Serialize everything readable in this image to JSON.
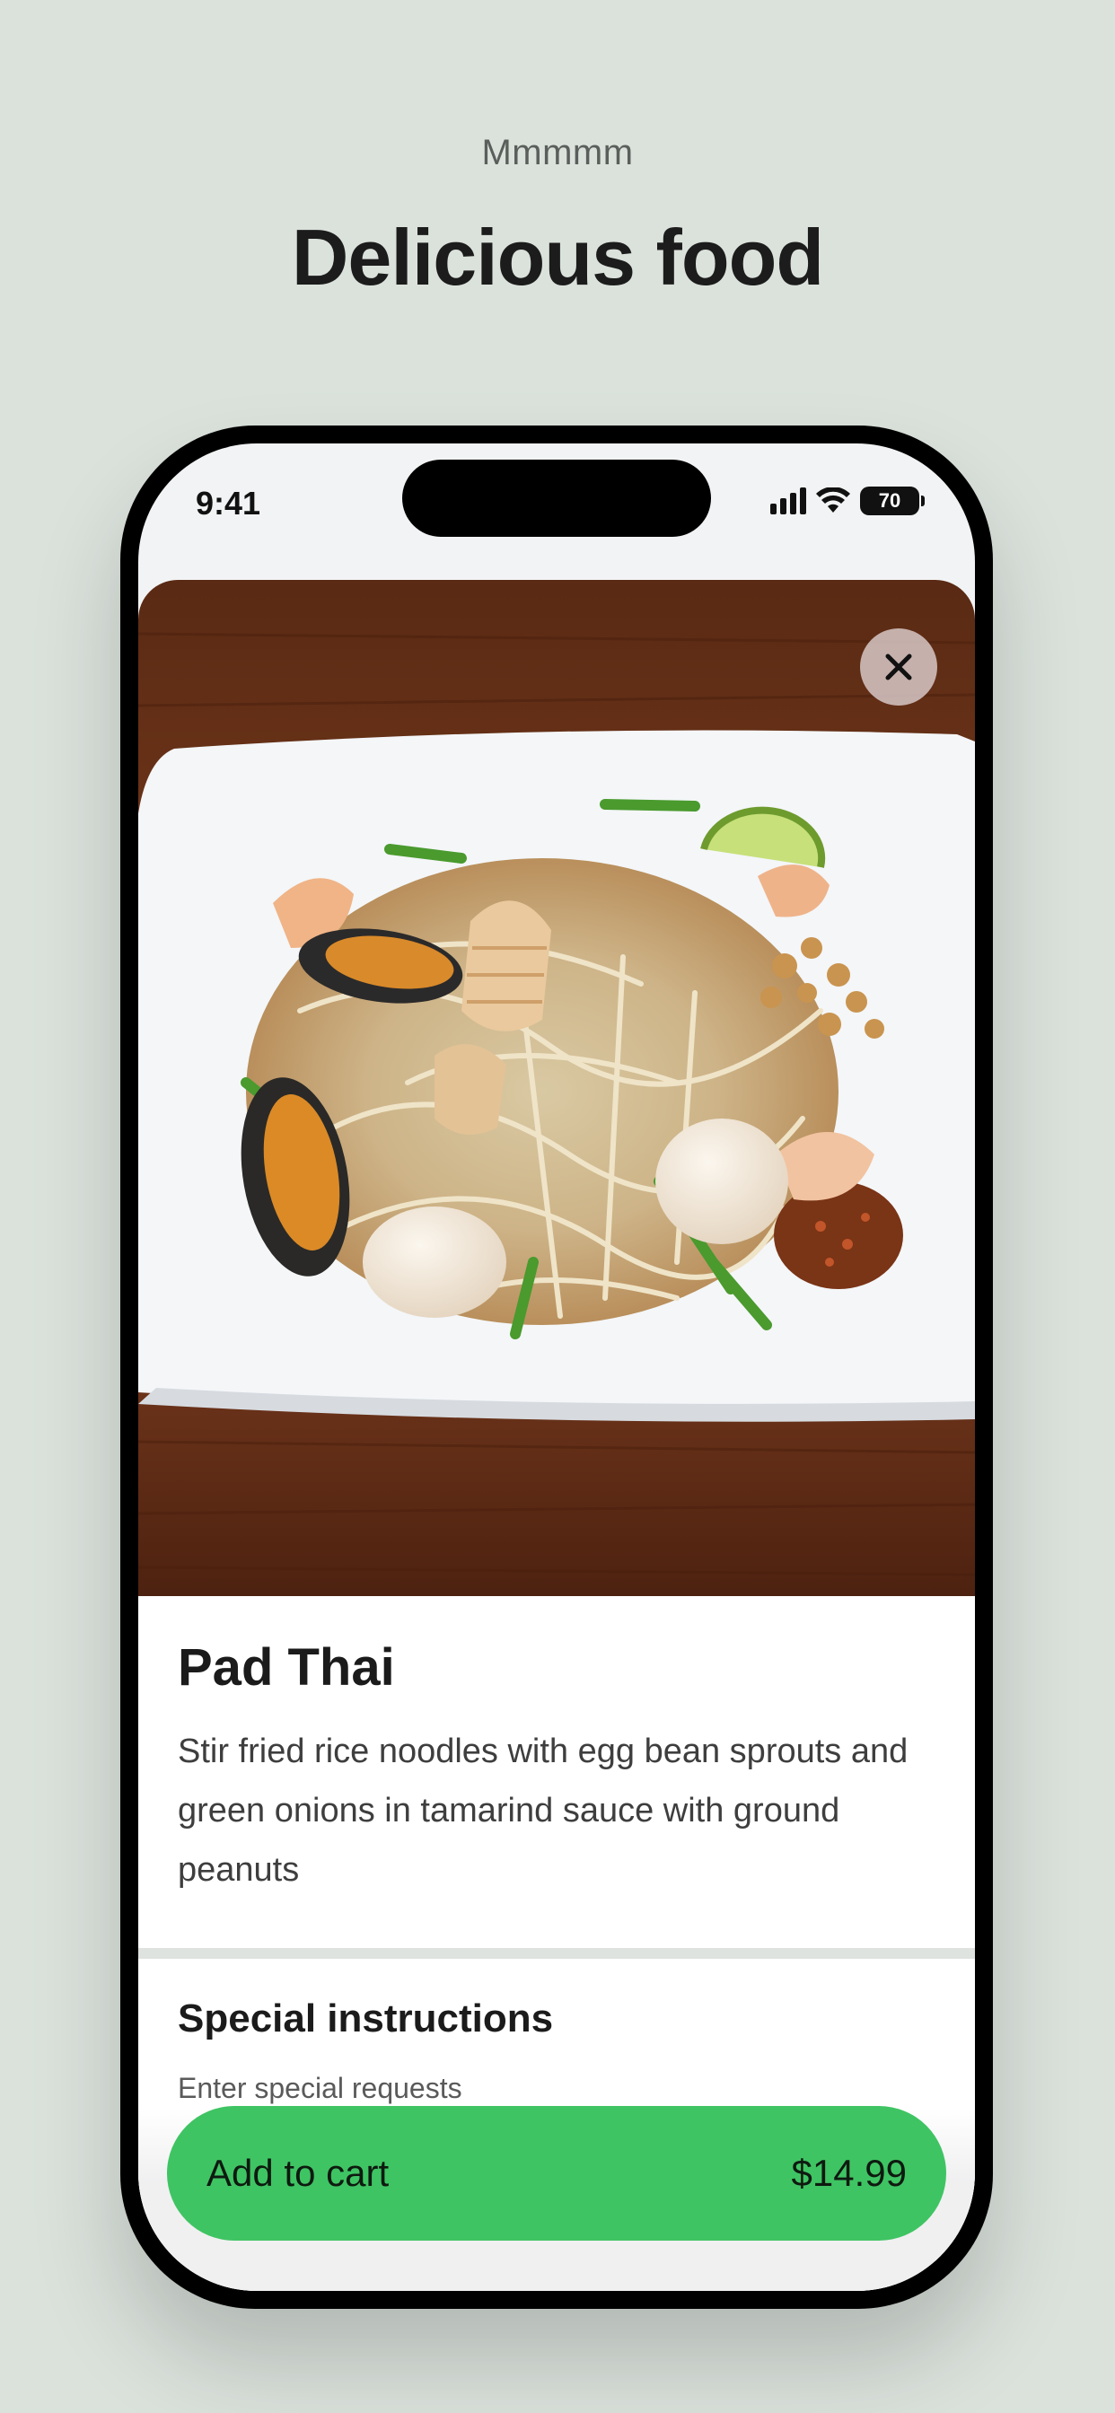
{
  "header": {
    "eyebrow": "Mmmmm",
    "title": "Delicious food"
  },
  "status_bar": {
    "time": "9:41",
    "battery": "70"
  },
  "item": {
    "name": "Pad Thai",
    "description": "Stir fried rice noodles with egg bean sprouts and green onions in tamarind sauce with ground peanuts",
    "photo": "pad-thai-plate-photo"
  },
  "special_instructions": {
    "title": "Special instructions",
    "placeholder": "Enter special requests"
  },
  "cart": {
    "label": "Add to cart",
    "price": "$14.99"
  },
  "icons": {
    "close": "close-icon",
    "signal": "cellular-signal-icon",
    "wifi": "wifi-icon",
    "battery": "battery-icon"
  },
  "colors": {
    "page_background": "#dbe2dc",
    "accent": "#3fc463",
    "text": "#1b1b1b"
  }
}
